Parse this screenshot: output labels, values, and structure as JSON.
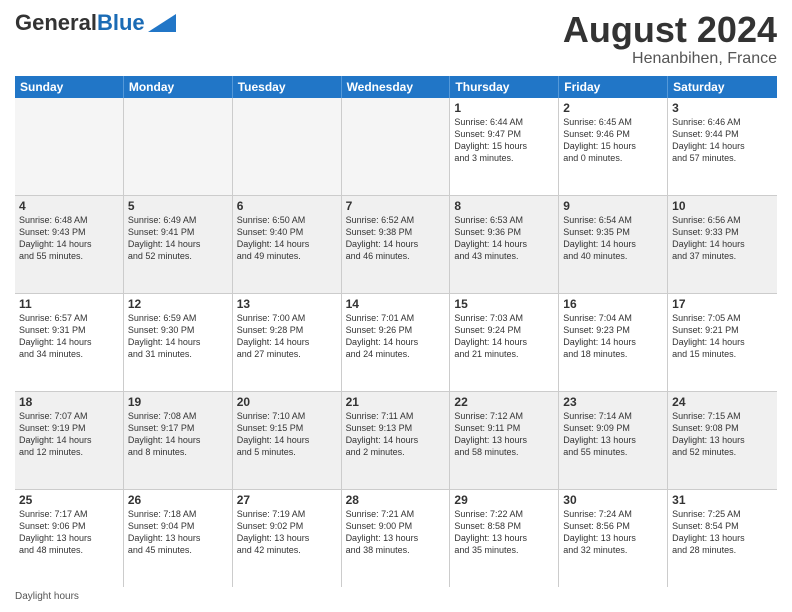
{
  "header": {
    "logo_general": "General",
    "logo_blue": "Blue",
    "month_year": "August 2024",
    "location": "Henanbihen, France"
  },
  "days_of_week": [
    "Sunday",
    "Monday",
    "Tuesday",
    "Wednesday",
    "Thursday",
    "Friday",
    "Saturday"
  ],
  "footer": {
    "label": "Daylight hours"
  },
  "weeks": [
    [
      {
        "day": "",
        "info": ""
      },
      {
        "day": "",
        "info": ""
      },
      {
        "day": "",
        "info": ""
      },
      {
        "day": "",
        "info": ""
      },
      {
        "day": "1",
        "info": "Sunrise: 6:44 AM\nSunset: 9:47 PM\nDaylight: 15 hours\nand 3 minutes."
      },
      {
        "day": "2",
        "info": "Sunrise: 6:45 AM\nSunset: 9:46 PM\nDaylight: 15 hours\nand 0 minutes."
      },
      {
        "day": "3",
        "info": "Sunrise: 6:46 AM\nSunset: 9:44 PM\nDaylight: 14 hours\nand 57 minutes."
      }
    ],
    [
      {
        "day": "4",
        "info": "Sunrise: 6:48 AM\nSunset: 9:43 PM\nDaylight: 14 hours\nand 55 minutes."
      },
      {
        "day": "5",
        "info": "Sunrise: 6:49 AM\nSunset: 9:41 PM\nDaylight: 14 hours\nand 52 minutes."
      },
      {
        "day": "6",
        "info": "Sunrise: 6:50 AM\nSunset: 9:40 PM\nDaylight: 14 hours\nand 49 minutes."
      },
      {
        "day": "7",
        "info": "Sunrise: 6:52 AM\nSunset: 9:38 PM\nDaylight: 14 hours\nand 46 minutes."
      },
      {
        "day": "8",
        "info": "Sunrise: 6:53 AM\nSunset: 9:36 PM\nDaylight: 14 hours\nand 43 minutes."
      },
      {
        "day": "9",
        "info": "Sunrise: 6:54 AM\nSunset: 9:35 PM\nDaylight: 14 hours\nand 40 minutes."
      },
      {
        "day": "10",
        "info": "Sunrise: 6:56 AM\nSunset: 9:33 PM\nDaylight: 14 hours\nand 37 minutes."
      }
    ],
    [
      {
        "day": "11",
        "info": "Sunrise: 6:57 AM\nSunset: 9:31 PM\nDaylight: 14 hours\nand 34 minutes."
      },
      {
        "day": "12",
        "info": "Sunrise: 6:59 AM\nSunset: 9:30 PM\nDaylight: 14 hours\nand 31 minutes."
      },
      {
        "day": "13",
        "info": "Sunrise: 7:00 AM\nSunset: 9:28 PM\nDaylight: 14 hours\nand 27 minutes."
      },
      {
        "day": "14",
        "info": "Sunrise: 7:01 AM\nSunset: 9:26 PM\nDaylight: 14 hours\nand 24 minutes."
      },
      {
        "day": "15",
        "info": "Sunrise: 7:03 AM\nSunset: 9:24 PM\nDaylight: 14 hours\nand 21 minutes."
      },
      {
        "day": "16",
        "info": "Sunrise: 7:04 AM\nSunset: 9:23 PM\nDaylight: 14 hours\nand 18 minutes."
      },
      {
        "day": "17",
        "info": "Sunrise: 7:05 AM\nSunset: 9:21 PM\nDaylight: 14 hours\nand 15 minutes."
      }
    ],
    [
      {
        "day": "18",
        "info": "Sunrise: 7:07 AM\nSunset: 9:19 PM\nDaylight: 14 hours\nand 12 minutes."
      },
      {
        "day": "19",
        "info": "Sunrise: 7:08 AM\nSunset: 9:17 PM\nDaylight: 14 hours\nand 8 minutes."
      },
      {
        "day": "20",
        "info": "Sunrise: 7:10 AM\nSunset: 9:15 PM\nDaylight: 14 hours\nand 5 minutes."
      },
      {
        "day": "21",
        "info": "Sunrise: 7:11 AM\nSunset: 9:13 PM\nDaylight: 14 hours\nand 2 minutes."
      },
      {
        "day": "22",
        "info": "Sunrise: 7:12 AM\nSunset: 9:11 PM\nDaylight: 13 hours\nand 58 minutes."
      },
      {
        "day": "23",
        "info": "Sunrise: 7:14 AM\nSunset: 9:09 PM\nDaylight: 13 hours\nand 55 minutes."
      },
      {
        "day": "24",
        "info": "Sunrise: 7:15 AM\nSunset: 9:08 PM\nDaylight: 13 hours\nand 52 minutes."
      }
    ],
    [
      {
        "day": "25",
        "info": "Sunrise: 7:17 AM\nSunset: 9:06 PM\nDaylight: 13 hours\nand 48 minutes."
      },
      {
        "day": "26",
        "info": "Sunrise: 7:18 AM\nSunset: 9:04 PM\nDaylight: 13 hours\nand 45 minutes."
      },
      {
        "day": "27",
        "info": "Sunrise: 7:19 AM\nSunset: 9:02 PM\nDaylight: 13 hours\nand 42 minutes."
      },
      {
        "day": "28",
        "info": "Sunrise: 7:21 AM\nSunset: 9:00 PM\nDaylight: 13 hours\nand 38 minutes."
      },
      {
        "day": "29",
        "info": "Sunrise: 7:22 AM\nSunset: 8:58 PM\nDaylight: 13 hours\nand 35 minutes."
      },
      {
        "day": "30",
        "info": "Sunrise: 7:24 AM\nSunset: 8:56 PM\nDaylight: 13 hours\nand 32 minutes."
      },
      {
        "day": "31",
        "info": "Sunrise: 7:25 AM\nSunset: 8:54 PM\nDaylight: 13 hours\nand 28 minutes."
      }
    ]
  ]
}
